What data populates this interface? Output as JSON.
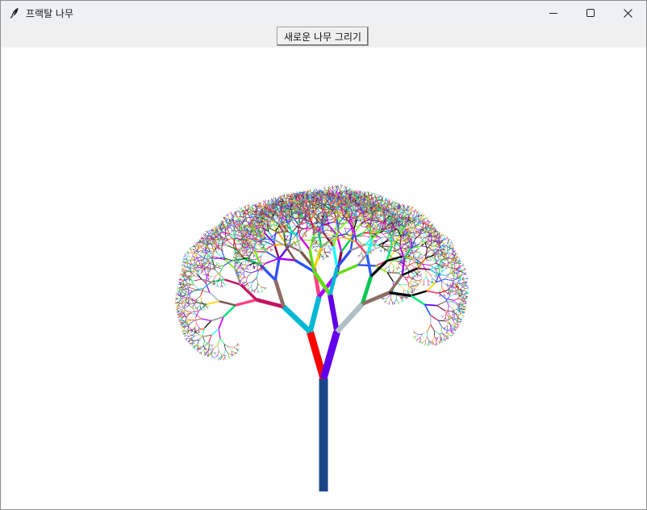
{
  "window": {
    "title": "프랙탈 나무",
    "app_icon": "feather-icon",
    "controls": {
      "minimize_icon": "minimize-icon",
      "maximize_icon": "maximize-icon",
      "close_icon": "close-icon"
    }
  },
  "toolbar": {
    "draw_button_label": "새로운 나무 그리기"
  },
  "canvas": {
    "content": "fractal-tree",
    "trunk_color": "#1c4587",
    "palette": [
      "#ff0000",
      "#00c853",
      "#2962ff",
      "#ffd600",
      "#aa00ff",
      "#00b8d4",
      "#ff6d00",
      "#c51162",
      "#64dd17",
      "#6200ea",
      "#795548",
      "#9e9e9e",
      "#000000",
      "#ff4081",
      "#18ffff",
      "#76ff03",
      "#d500f9",
      "#ffab00",
      "#304ffe",
      "#00e676",
      "#8d6e63",
      "#b0bec5",
      "#33691e",
      "#880e4f"
    ]
  }
}
